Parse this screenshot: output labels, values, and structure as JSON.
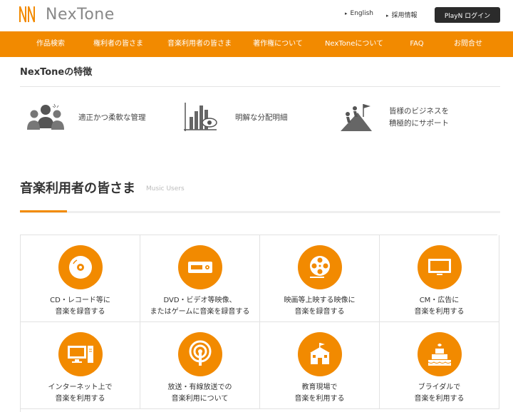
{
  "header": {
    "logo_text": "NexTone",
    "links": [
      "English",
      "採用情報"
    ],
    "login_label": "PlayN ログイン"
  },
  "nav": {
    "items": [
      "作品検索",
      "権利者の皆さま",
      "音楽利用者の皆さま",
      "著作権について",
      "NexToneについて",
      "FAQ",
      "お問合せ"
    ]
  },
  "features": {
    "title": "NexToneの特徴",
    "items": [
      {
        "label": "適正かつ柔軟な管理",
        "icon": "people-icon"
      },
      {
        "label": "明解な分配明細",
        "icon": "bar-chart-eye-icon"
      },
      {
        "label_line1": "皆様のビジネスを",
        "label_line2": "積極的にサポート",
        "icon": "mountain-climb-icon"
      }
    ]
  },
  "section": {
    "title": "音楽利用者の皆さま",
    "subtitle": "Music Users"
  },
  "grid": {
    "items": [
      {
        "line1": "CD・レコード等に",
        "line2": "音楽を録音する",
        "icon": "cd-icon"
      },
      {
        "line1": "DVD・ビデオ等映像、",
        "line2": "またはゲームに音楽を録音する",
        "icon": "dvd-player-icon"
      },
      {
        "line1": "映画等上映する映像に",
        "line2": "音楽を録音する",
        "icon": "film-reel-icon"
      },
      {
        "line1": "CM・広告に",
        "line2": "音楽を利用する",
        "icon": "tv-icon"
      },
      {
        "line1": "インターネット上で",
        "line2": "音楽を利用する",
        "icon": "computer-icon"
      },
      {
        "line1": "放送・有線放送での",
        "line2": "音楽利用について",
        "icon": "broadcast-icon"
      },
      {
        "line1": "教育現場で",
        "line2": "音楽を利用する",
        "icon": "school-icon"
      },
      {
        "line1": "ブライダルで",
        "line2": "音楽を利用する",
        "icon": "wedding-cake-icon"
      }
    ]
  },
  "colors": {
    "accent": "#f28a00",
    "dark": "#2b2b2b"
  }
}
